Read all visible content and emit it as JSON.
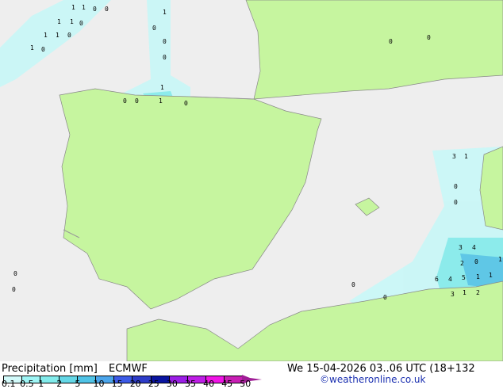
{
  "map": {
    "sea_color": "#eeeeee",
    "land_color": "#c6f59f",
    "border_color": "#a0a0a0",
    "precip_values": [
      "1",
      "1",
      "0",
      "0",
      "1",
      "1",
      "0",
      "1",
      "1",
      "1",
      "0",
      "0",
      "1",
      "0",
      "0",
      "0",
      "1",
      "0",
      "0",
      "1",
      "0",
      "0",
      "0",
      "3",
      "1",
      "0",
      "0",
      "3",
      "4",
      "2",
      "0",
      "1",
      "6",
      "4",
      "5",
      "1",
      "1",
      "3",
      "1",
      "2",
      "0",
      "0",
      "0",
      "0"
    ]
  },
  "legend": {
    "title": "Precipitation [mm]",
    "model": "ECMWF",
    "datetime": "We 15-04-2026 03..06 UTC (18+132",
    "copyright": "©weatheronline.co.uk",
    "ticks": [
      "0.1",
      "0.5",
      "1",
      "2",
      "5",
      "10",
      "15",
      "20",
      "25",
      "30",
      "35",
      "40",
      "45",
      "50"
    ],
    "colors": [
      "#d2fafa",
      "#9ef5f5",
      "#82ebeb",
      "#64d7e6",
      "#50c3e6",
      "#4ba5eb",
      "#3c5ae6",
      "#2d3cc8",
      "#0a14a0",
      "#9b1ee6",
      "#be1ee6",
      "#f014e6",
      "#c81eb4"
    ],
    "arrow_color": "#a01e96"
  }
}
